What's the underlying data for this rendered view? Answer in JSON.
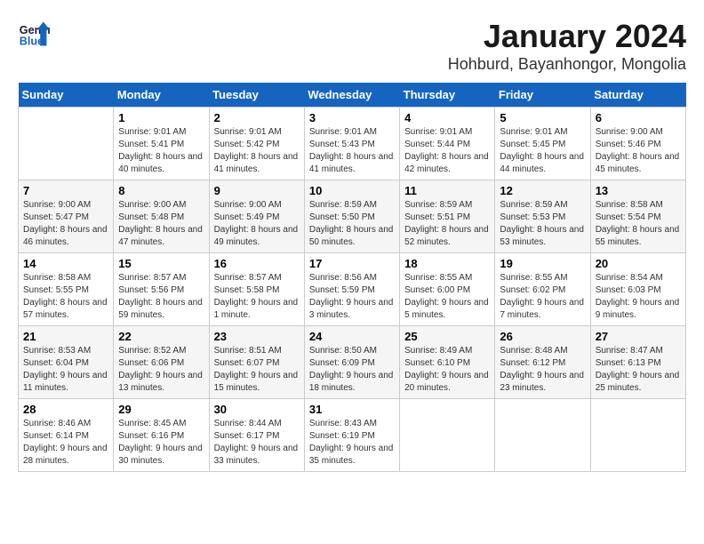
{
  "logo": {
    "general": "General",
    "blue": "Blue"
  },
  "title": "January 2024",
  "location": "Hohburd, Bayanhongor, Mongolia",
  "weekdays": [
    "Sunday",
    "Monday",
    "Tuesday",
    "Wednesday",
    "Thursday",
    "Friday",
    "Saturday"
  ],
  "weeks": [
    [
      {
        "day": "",
        "sunrise": "",
        "sunset": "",
        "daylight": ""
      },
      {
        "day": "1",
        "sunrise": "Sunrise: 9:01 AM",
        "sunset": "Sunset: 5:41 PM",
        "daylight": "Daylight: 8 hours and 40 minutes."
      },
      {
        "day": "2",
        "sunrise": "Sunrise: 9:01 AM",
        "sunset": "Sunset: 5:42 PM",
        "daylight": "Daylight: 8 hours and 41 minutes."
      },
      {
        "day": "3",
        "sunrise": "Sunrise: 9:01 AM",
        "sunset": "Sunset: 5:43 PM",
        "daylight": "Daylight: 8 hours and 41 minutes."
      },
      {
        "day": "4",
        "sunrise": "Sunrise: 9:01 AM",
        "sunset": "Sunset: 5:44 PM",
        "daylight": "Daylight: 8 hours and 42 minutes."
      },
      {
        "day": "5",
        "sunrise": "Sunrise: 9:01 AM",
        "sunset": "Sunset: 5:45 PM",
        "daylight": "Daylight: 8 hours and 44 minutes."
      },
      {
        "day": "6",
        "sunrise": "Sunrise: 9:00 AM",
        "sunset": "Sunset: 5:46 PM",
        "daylight": "Daylight: 8 hours and 45 minutes."
      }
    ],
    [
      {
        "day": "7",
        "sunrise": "Sunrise: 9:00 AM",
        "sunset": "Sunset: 5:47 PM",
        "daylight": "Daylight: 8 hours and 46 minutes."
      },
      {
        "day": "8",
        "sunrise": "Sunrise: 9:00 AM",
        "sunset": "Sunset: 5:48 PM",
        "daylight": "Daylight: 8 hours and 47 minutes."
      },
      {
        "day": "9",
        "sunrise": "Sunrise: 9:00 AM",
        "sunset": "Sunset: 5:49 PM",
        "daylight": "Daylight: 8 hours and 49 minutes."
      },
      {
        "day": "10",
        "sunrise": "Sunrise: 8:59 AM",
        "sunset": "Sunset: 5:50 PM",
        "daylight": "Daylight: 8 hours and 50 minutes."
      },
      {
        "day": "11",
        "sunrise": "Sunrise: 8:59 AM",
        "sunset": "Sunset: 5:51 PM",
        "daylight": "Daylight: 8 hours and 52 minutes."
      },
      {
        "day": "12",
        "sunrise": "Sunrise: 8:59 AM",
        "sunset": "Sunset: 5:53 PM",
        "daylight": "Daylight: 8 hours and 53 minutes."
      },
      {
        "day": "13",
        "sunrise": "Sunrise: 8:58 AM",
        "sunset": "Sunset: 5:54 PM",
        "daylight": "Daylight: 8 hours and 55 minutes."
      }
    ],
    [
      {
        "day": "14",
        "sunrise": "Sunrise: 8:58 AM",
        "sunset": "Sunset: 5:55 PM",
        "daylight": "Daylight: 8 hours and 57 minutes."
      },
      {
        "day": "15",
        "sunrise": "Sunrise: 8:57 AM",
        "sunset": "Sunset: 5:56 PM",
        "daylight": "Daylight: 8 hours and 59 minutes."
      },
      {
        "day": "16",
        "sunrise": "Sunrise: 8:57 AM",
        "sunset": "Sunset: 5:58 PM",
        "daylight": "Daylight: 9 hours and 1 minute."
      },
      {
        "day": "17",
        "sunrise": "Sunrise: 8:56 AM",
        "sunset": "Sunset: 5:59 PM",
        "daylight": "Daylight: 9 hours and 3 minutes."
      },
      {
        "day": "18",
        "sunrise": "Sunrise: 8:55 AM",
        "sunset": "Sunset: 6:00 PM",
        "daylight": "Daylight: 9 hours and 5 minutes."
      },
      {
        "day": "19",
        "sunrise": "Sunrise: 8:55 AM",
        "sunset": "Sunset: 6:02 PM",
        "daylight": "Daylight: 9 hours and 7 minutes."
      },
      {
        "day": "20",
        "sunrise": "Sunrise: 8:54 AM",
        "sunset": "Sunset: 6:03 PM",
        "daylight": "Daylight: 9 hours and 9 minutes."
      }
    ],
    [
      {
        "day": "21",
        "sunrise": "Sunrise: 8:53 AM",
        "sunset": "Sunset: 6:04 PM",
        "daylight": "Daylight: 9 hours and 11 minutes."
      },
      {
        "day": "22",
        "sunrise": "Sunrise: 8:52 AM",
        "sunset": "Sunset: 6:06 PM",
        "daylight": "Daylight: 9 hours and 13 minutes."
      },
      {
        "day": "23",
        "sunrise": "Sunrise: 8:51 AM",
        "sunset": "Sunset: 6:07 PM",
        "daylight": "Daylight: 9 hours and 15 minutes."
      },
      {
        "day": "24",
        "sunrise": "Sunrise: 8:50 AM",
        "sunset": "Sunset: 6:09 PM",
        "daylight": "Daylight: 9 hours and 18 minutes."
      },
      {
        "day": "25",
        "sunrise": "Sunrise: 8:49 AM",
        "sunset": "Sunset: 6:10 PM",
        "daylight": "Daylight: 9 hours and 20 minutes."
      },
      {
        "day": "26",
        "sunrise": "Sunrise: 8:48 AM",
        "sunset": "Sunset: 6:12 PM",
        "daylight": "Daylight: 9 hours and 23 minutes."
      },
      {
        "day": "27",
        "sunrise": "Sunrise: 8:47 AM",
        "sunset": "Sunset: 6:13 PM",
        "daylight": "Daylight: 9 hours and 25 minutes."
      }
    ],
    [
      {
        "day": "28",
        "sunrise": "Sunrise: 8:46 AM",
        "sunset": "Sunset: 6:14 PM",
        "daylight": "Daylight: 9 hours and 28 minutes."
      },
      {
        "day": "29",
        "sunrise": "Sunrise: 8:45 AM",
        "sunset": "Sunset: 6:16 PM",
        "daylight": "Daylight: 9 hours and 30 minutes."
      },
      {
        "day": "30",
        "sunrise": "Sunrise: 8:44 AM",
        "sunset": "Sunset: 6:17 PM",
        "daylight": "Daylight: 9 hours and 33 minutes."
      },
      {
        "day": "31",
        "sunrise": "Sunrise: 8:43 AM",
        "sunset": "Sunset: 6:19 PM",
        "daylight": "Daylight: 9 hours and 35 minutes."
      },
      {
        "day": "",
        "sunrise": "",
        "sunset": "",
        "daylight": ""
      },
      {
        "day": "",
        "sunrise": "",
        "sunset": "",
        "daylight": ""
      },
      {
        "day": "",
        "sunrise": "",
        "sunset": "",
        "daylight": ""
      }
    ]
  ]
}
